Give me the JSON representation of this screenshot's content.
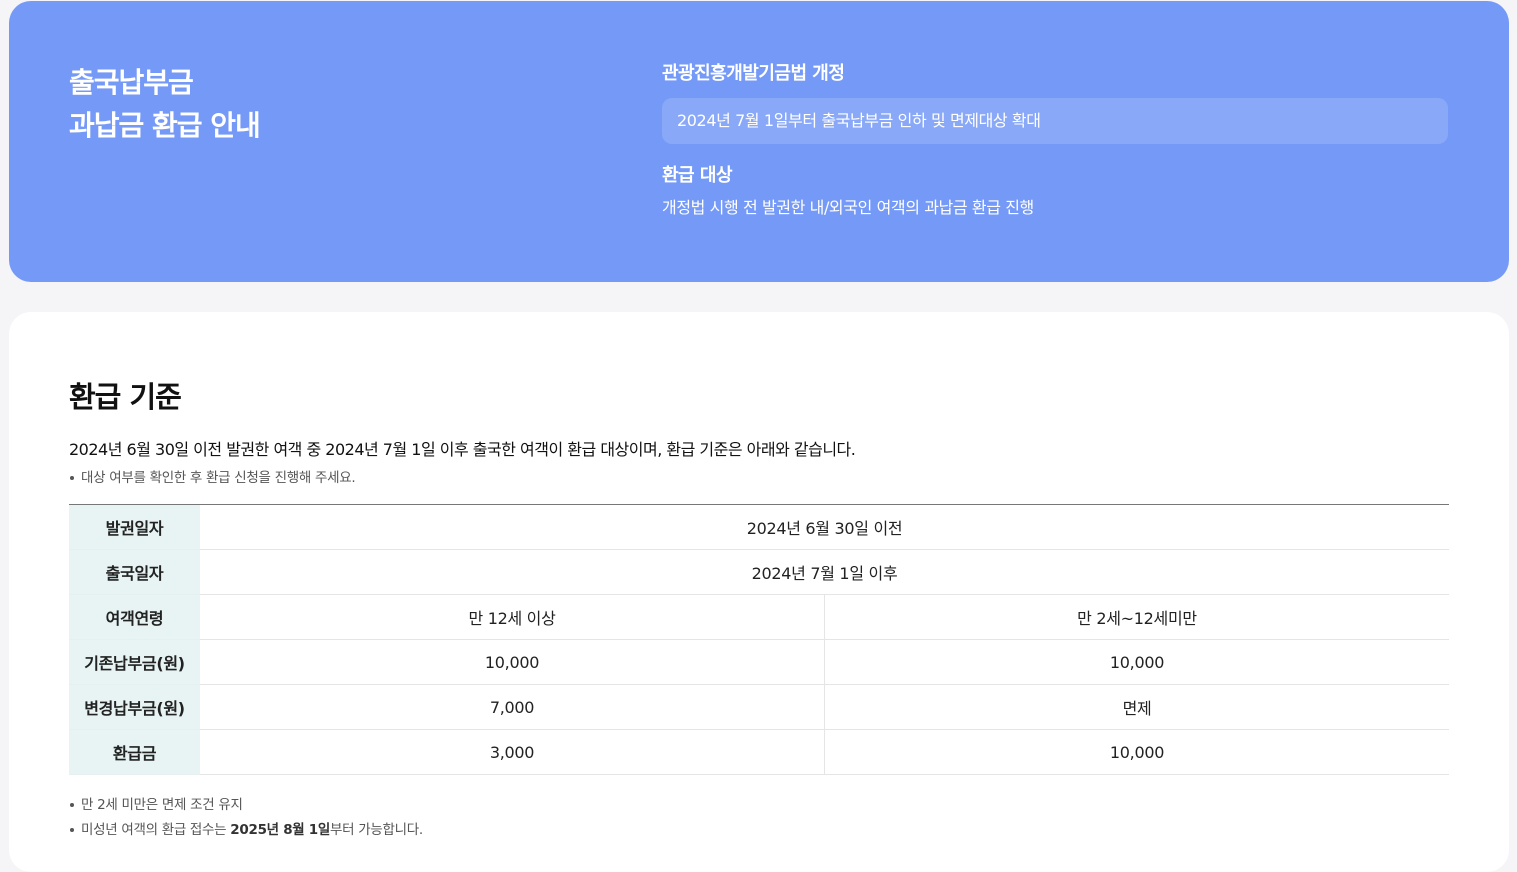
{
  "banner": {
    "title_line1": "출국납부금",
    "title_line2": "과납금 환급 안내",
    "amendment_heading": "관광진흥개발기금법 개정",
    "amendment_text": "2024년 7월 1일부터 출국납부금 인하 및 면제대상 확대",
    "target_heading": "환급 대상",
    "target_text": "개정법 시행 전 발권한 내/외국인 여객의 과납금 환급 진행"
  },
  "criteria": {
    "title": "환급 기준",
    "description": "2024년 6월 30일 이전 발권한 여객 중 2024년 7월 1일 이후 출국한 여객이 환급 대상이며, 환급 기준은 아래와 같습니다.",
    "note_top": "대상 여부를 확인한 후 환급 신청을 진행해 주세요.",
    "table": {
      "rows": [
        {
          "header": "발권일자",
          "value": "2024년 6월 30일 이전"
        },
        {
          "header": "출국일자",
          "value": "2024년 7월 1일 이후"
        },
        {
          "header": "여객연령",
          "left": "만 12세 이상",
          "right": "만 2세~12세미만"
        },
        {
          "header": "기존납부금(원)",
          "left": "10,000",
          "right": "10,000"
        },
        {
          "header": "변경납부금(원)",
          "left": "7,000",
          "right": "면제"
        },
        {
          "header": "환급금",
          "left": "3,000",
          "right": "10,000"
        }
      ]
    },
    "note_1": "만 2세 미만은 면제 조건 유지",
    "note_2_prefix": "미성년 여객의 환급 접수는 ",
    "note_2_bold": "2025년 8월 1일",
    "note_2_suffix": "부터 가능합니다."
  }
}
